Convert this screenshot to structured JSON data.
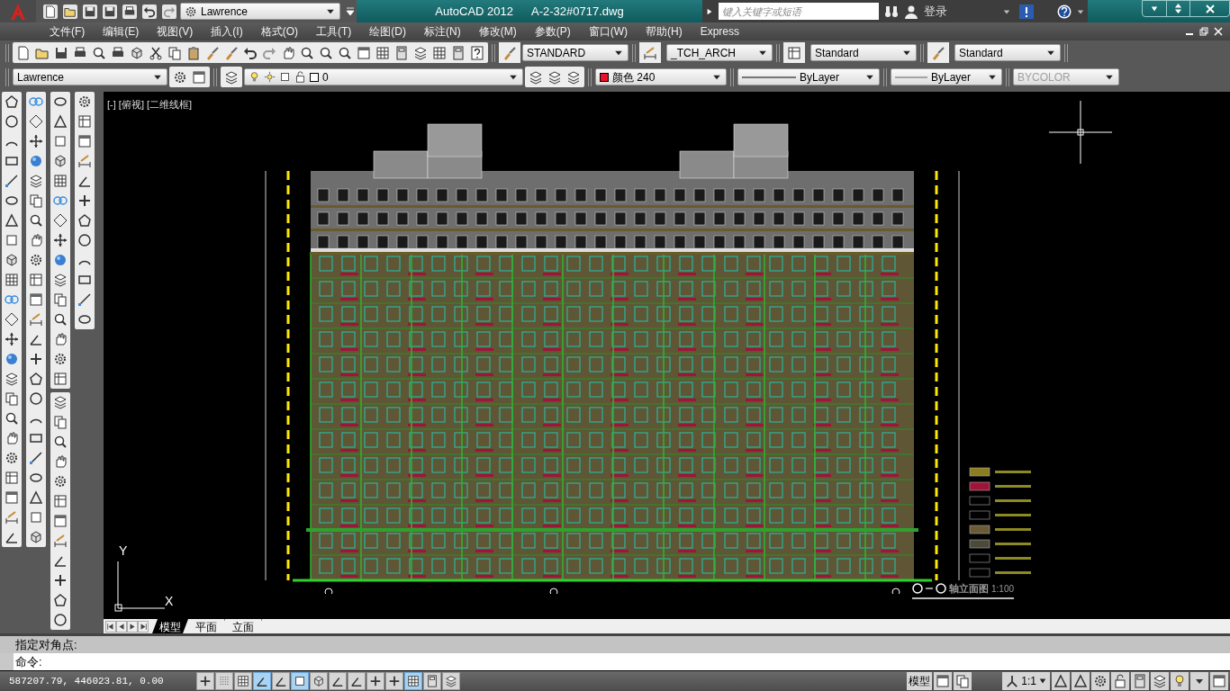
{
  "workspace": "Lawrence",
  "title": "AutoCAD 2012",
  "file_name": "A-2-32#0717.dwg",
  "search": {
    "placeholder": "键入关键字或短语"
  },
  "sign_in": "登录",
  "menu": [
    "文件(F)",
    "编辑(E)",
    "视图(V)",
    "插入(I)",
    "格式(O)",
    "工具(T)",
    "绘图(D)",
    "标注(N)",
    "修改(M)",
    "参数(P)",
    "窗口(W)",
    "帮助(H)",
    "Express"
  ],
  "styles": [
    {
      "kind": "text",
      "value": "STANDARD"
    },
    {
      "kind": "dimension",
      "value": "_TCH_ARCH"
    },
    {
      "kind": "table",
      "value": "Standard"
    },
    {
      "kind": "leader",
      "value": "Standard"
    }
  ],
  "workspace_combo": "Lawrence",
  "layer": "0",
  "color_control": "颜色 240",
  "linetype": "ByLayer",
  "lineweight": "ByLayer",
  "plot_style": {
    "value": "BYCOLOR",
    "disabled": true
  },
  "viewport_label": "[-] [俯视] [二维线框]",
  "ucs": {
    "y": "Y",
    "x": "X"
  },
  "drawing_caption": {
    "title": "轴立面图",
    "scale": "1:100"
  },
  "layout_tabs": [
    {
      "label": "模型",
      "selected": true
    },
    {
      "label": "平面",
      "selected": false
    },
    {
      "label": "立面",
      "selected": false
    }
  ],
  "command": {
    "history": "指定对角点:",
    "prompt": "命令:"
  },
  "status": {
    "coords": "587207.79, 446023.81, 0.00",
    "toggles": [
      {
        "on": false
      },
      {
        "on": false
      },
      {
        "on": false
      },
      {
        "on": true
      },
      {
        "on": false
      },
      {
        "on": true
      },
      {
        "on": false
      },
      {
        "on": false
      },
      {
        "on": false
      },
      {
        "on": false
      },
      {
        "on": false
      },
      {
        "on": true
      },
      {
        "on": false
      },
      {
        "on": false
      }
    ],
    "model": "模型",
    "annotation_scale": "1:1"
  }
}
